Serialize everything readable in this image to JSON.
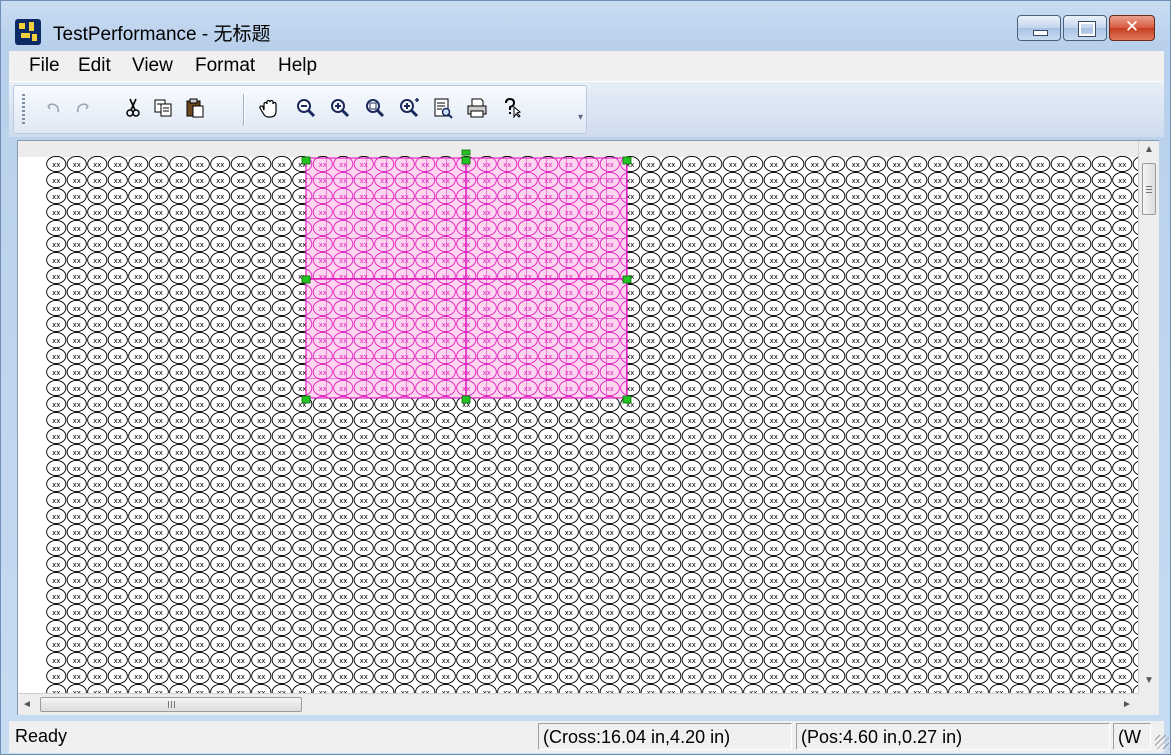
{
  "window": {
    "title": "TestPerformance - 无标题",
    "icon": "app-icon",
    "caption_buttons": [
      "minimize-icon",
      "maximize-icon",
      "close-icon"
    ],
    "close_glyph": "✕"
  },
  "menu": {
    "items": [
      "File",
      "Edit",
      "View",
      "Format",
      "Help"
    ]
  },
  "toolbar": {
    "buttons": [
      {
        "name": "undo",
        "icon": "undo-icon"
      },
      {
        "name": "redo",
        "icon": "redo-icon"
      },
      {
        "name": "cut",
        "icon": "scissors-icon"
      },
      {
        "name": "copy",
        "icon": "copy-icon"
      },
      {
        "name": "paste",
        "icon": "paste-icon"
      },
      {
        "name": "pan",
        "icon": "hand-icon"
      },
      {
        "name": "zoom-out",
        "icon": "zoom-out-icon"
      },
      {
        "name": "zoom-in",
        "icon": "zoom-in-icon"
      },
      {
        "name": "zoom-fit",
        "icon": "zoom-fit-icon"
      },
      {
        "name": "zoom-plus",
        "icon": "zoom-plus-icon"
      },
      {
        "name": "print-preview",
        "icon": "print-preview-icon"
      },
      {
        "name": "print",
        "icon": "printer-icon"
      },
      {
        "name": "help",
        "icon": "help-pointer-icon"
      }
    ]
  },
  "canvas": {
    "symbol_text": "xx",
    "pattern": "grid of circled symbols",
    "selection": {
      "color": "#e020c0",
      "handle_color": "#22c322"
    }
  },
  "scrollbars": {
    "vertical_up": "▲",
    "vertical_down": "▼",
    "horizontal_left": "◄",
    "horizontal_right": "►",
    "thumb_grip": "III"
  },
  "status": {
    "ready": "Ready",
    "cross": "(Cross:16.04 in,4.20 in)",
    "pos": "(Pos:4.60 in,0.27 in)",
    "extra": "(W"
  }
}
